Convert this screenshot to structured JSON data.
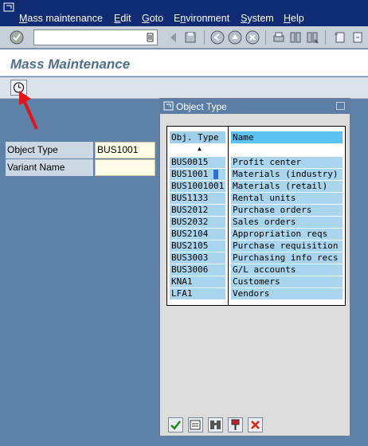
{
  "menubar": {
    "items": [
      {
        "label": "Mass maintenance",
        "underline": "M"
      },
      {
        "label": "Edit",
        "underline": "E"
      },
      {
        "label": "Goto",
        "underline": "G"
      },
      {
        "label": "Environment",
        "underline": "n"
      },
      {
        "label": "System",
        "underline": "S"
      },
      {
        "label": "Help",
        "underline": "H"
      }
    ]
  },
  "toolbar": {
    "command_value": "",
    "icons": [
      "enter-icon",
      "back-icon",
      "save-icon",
      "back-green-icon",
      "exit-icon",
      "cancel-icon",
      "print-icon",
      "find-icon",
      "find-next-icon",
      "first-page-icon"
    ]
  },
  "page": {
    "title": "Mass Maintenance"
  },
  "form": {
    "object_type_label": "Object Type",
    "object_type_value": "BUS1001",
    "variant_name_label": "Variant Name",
    "variant_name_value": ""
  },
  "dialog": {
    "title": "Object Type",
    "columns": {
      "obj_type": "Obj. Type",
      "name": "Name"
    },
    "rows": [
      {
        "obj_type": "BUS0015",
        "name": "Profit center"
      },
      {
        "obj_type": "BUS1001",
        "name": "Materials (industry)"
      },
      {
        "obj_type": "BUS1001001",
        "name": "Materials (retail)"
      },
      {
        "obj_type": "BUS1133",
        "name": "Rental units"
      },
      {
        "obj_type": "BUS2012",
        "name": "Purchase orders"
      },
      {
        "obj_type": "BUS2032",
        "name": "Sales orders"
      },
      {
        "obj_type": "BUS2104",
        "name": "Appropriation reqs"
      },
      {
        "obj_type": "BUS2105",
        "name": "Purchase requisition"
      },
      {
        "obj_type": "BUS3003",
        "name": "Purchasing info recs"
      },
      {
        "obj_type": "BUS3006",
        "name": "G/L accounts"
      },
      {
        "obj_type": "KNA1",
        "name": "Customers"
      },
      {
        "obj_type": "LFA1",
        "name": "Vendors"
      }
    ],
    "footer_icons": [
      "confirm-icon",
      "choose-icon",
      "search-icon",
      "sort-icon",
      "cancel-icon"
    ]
  },
  "colors": {
    "menubar": "#0e2b73",
    "background": "#5e82a8",
    "dialog_title": "#5b7da6",
    "cell": "#a9d5ee",
    "header_name": "#5bc2f2",
    "arrow": "#e0161a"
  }
}
